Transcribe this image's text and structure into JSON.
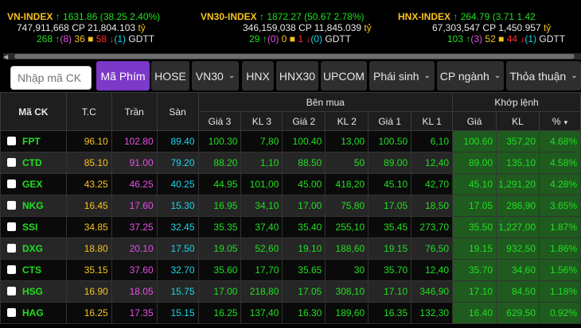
{
  "indices": [
    {
      "name": "VN-INDEX",
      "arrow": "↑",
      "value": "1631.86",
      "change": "(38.25",
      "pct": "2.40%)",
      "volume": "747,911,668",
      "cp_label": "CP",
      "cp_value": "21,804.103",
      "unit": "tỷ",
      "adv": "268",
      "adv_arrow": "↑",
      "ceil": "(8)",
      "unch": "36",
      "unch_sq": "■",
      "dec": "58",
      "dec_arrow": "↓",
      "floor": "(1)",
      "status": "GDTT"
    },
    {
      "name": "VN30-INDEX",
      "arrow": "↑",
      "value": "1872.27",
      "change": "(50.67",
      "pct": "2.78%)",
      "volume": "346,159,038",
      "cp_label": "CP",
      "cp_value": "11,845.039",
      "unit": "tỷ",
      "adv": "29",
      "adv_arrow": "↑",
      "ceil": "(0)",
      "unch": "0",
      "unch_sq": "■",
      "dec": "1",
      "dec_arrow": "↓",
      "floor": "(0)",
      "status": "GDTT"
    },
    {
      "name": "HNX-INDEX",
      "arrow": "↑",
      "value": "264.79",
      "change": "(3.71",
      "pct": "1.42",
      "volume": "67,303,547",
      "cp_label": "CP",
      "cp_value": "1,450.957",
      "unit": "tỷ",
      "adv": "103",
      "adv_arrow": "↑",
      "ceil": "(3)",
      "unch": "52",
      "unch_sq": "■",
      "dec": "44",
      "dec_arrow": "↓",
      "floor": "(1)",
      "status": "GDTT"
    }
  ],
  "search": {
    "placeholder": "Nhập mã CK"
  },
  "tabs": [
    {
      "label": "Mã Phím",
      "chev": ""
    },
    {
      "label": "HOSE",
      "chev": ""
    },
    {
      "label": "VN30",
      "chev": "⌄"
    },
    {
      "label": "HNX",
      "chev": ""
    },
    {
      "label": "HNX30",
      "chev": ""
    },
    {
      "label": "UPCOM",
      "chev": ""
    },
    {
      "label": "Phái sinh",
      "chev": "⌄"
    },
    {
      "label": "CP ngành",
      "chev": "⌄"
    },
    {
      "label": "Thỏa thuận",
      "chev": "⌄"
    }
  ],
  "header": {
    "symbol": "Mã CK",
    "ref": "T.C",
    "ceil": "Trần",
    "floor": "Sàn",
    "bid_group": "Bên mua",
    "match_group": "Khớp lệnh",
    "bid_cols": [
      "Giá 3",
      "KL 3",
      "Giá 2",
      "KL 2",
      "Giá 1",
      "KL 1"
    ],
    "match_cols": [
      "Giá",
      "KL",
      "%"
    ],
    "sort_icon": "▾"
  },
  "colors": {
    "up": "#1fe01f",
    "ceiling": "#e84ee8",
    "ref": "#f7c31c",
    "floor": "#1ad6e8",
    "accent": "#7b38c9"
  },
  "rows": [
    {
      "sym": "FPT",
      "tc": "96.10",
      "tran": "102.80",
      "san": "89.40",
      "g3": "100.30",
      "kl3": "7,80",
      "g2": "100.40",
      "kl2": "13,00",
      "g1": "100.50",
      "kl1": "6,10",
      "gia": "100.60",
      "kl": "357,20",
      "pct": "4.68%"
    },
    {
      "sym": "CTD",
      "tc": "85.10",
      "tran": "91.00",
      "san": "79.20",
      "g3": "88.20",
      "kl3": "1,10",
      "g2": "88.50",
      "kl2": "50",
      "g1": "89.00",
      "kl1": "12,40",
      "gia": "89.00",
      "kl": "135,10",
      "pct": "4.58%"
    },
    {
      "sym": "GEX",
      "tc": "43.25",
      "tran": "46.25",
      "san": "40.25",
      "g3": "44.95",
      "kl3": "101,00",
      "g2": "45.00",
      "kl2": "418,20",
      "g1": "45.10",
      "kl1": "42,70",
      "gia": "45.10",
      "kl": "1,291,20",
      "pct": "4.28%"
    },
    {
      "sym": "NKG",
      "tc": "16.45",
      "tran": "17.60",
      "san": "15.30",
      "g3": "16.95",
      "kl3": "34,10",
      "g2": "17.00",
      "kl2": "75,80",
      "g1": "17.05",
      "kl1": "18,50",
      "gia": "17.05",
      "kl": "286,90",
      "pct": "3.65%"
    },
    {
      "sym": "SSI",
      "tc": "34.85",
      "tran": "37.25",
      "san": "32.45",
      "g3": "35.35",
      "kl3": "37,40",
      "g2": "35.40",
      "kl2": "255,10",
      "g1": "35.45",
      "kl1": "273,70",
      "gia": "35.50",
      "kl": "1,227,00",
      "pct": "1.87%"
    },
    {
      "sym": "DXG",
      "tc": "18.80",
      "tran": "20.10",
      "san": "17.50",
      "g3": "19.05",
      "kl3": "52,60",
      "g2": "19.10",
      "kl2": "188,60",
      "g1": "19.15",
      "kl1": "76,50",
      "gia": "19.15",
      "kl": "932,50",
      "pct": "1.86%"
    },
    {
      "sym": "CTS",
      "tc": "35.15",
      "tran": "37.60",
      "san": "32.70",
      "g3": "35.60",
      "kl3": "17,70",
      "g2": "35.65",
      "kl2": "30",
      "g1": "35.70",
      "kl1": "12,40",
      "gia": "35.70",
      "kl": "34,60",
      "pct": "1.56%"
    },
    {
      "sym": "HSG",
      "tc": "16.90",
      "tran": "18.05",
      "san": "15.75",
      "g3": "17.00",
      "kl3": "218,80",
      "g2": "17.05",
      "kl2": "308,10",
      "g1": "17.10",
      "kl1": "346,90",
      "gia": "17.10",
      "kl": "84,50",
      "pct": "1.18%"
    },
    {
      "sym": "HAG",
      "tc": "16.25",
      "tran": "17.35",
      "san": "15.15",
      "g3": "16.25",
      "kl3": "137,40",
      "g2": "16.30",
      "kl2": "189,60",
      "g1": "16.35",
      "kl1": "132,30",
      "gia": "16.40",
      "kl": "629,50",
      "pct": "0.92%"
    }
  ]
}
